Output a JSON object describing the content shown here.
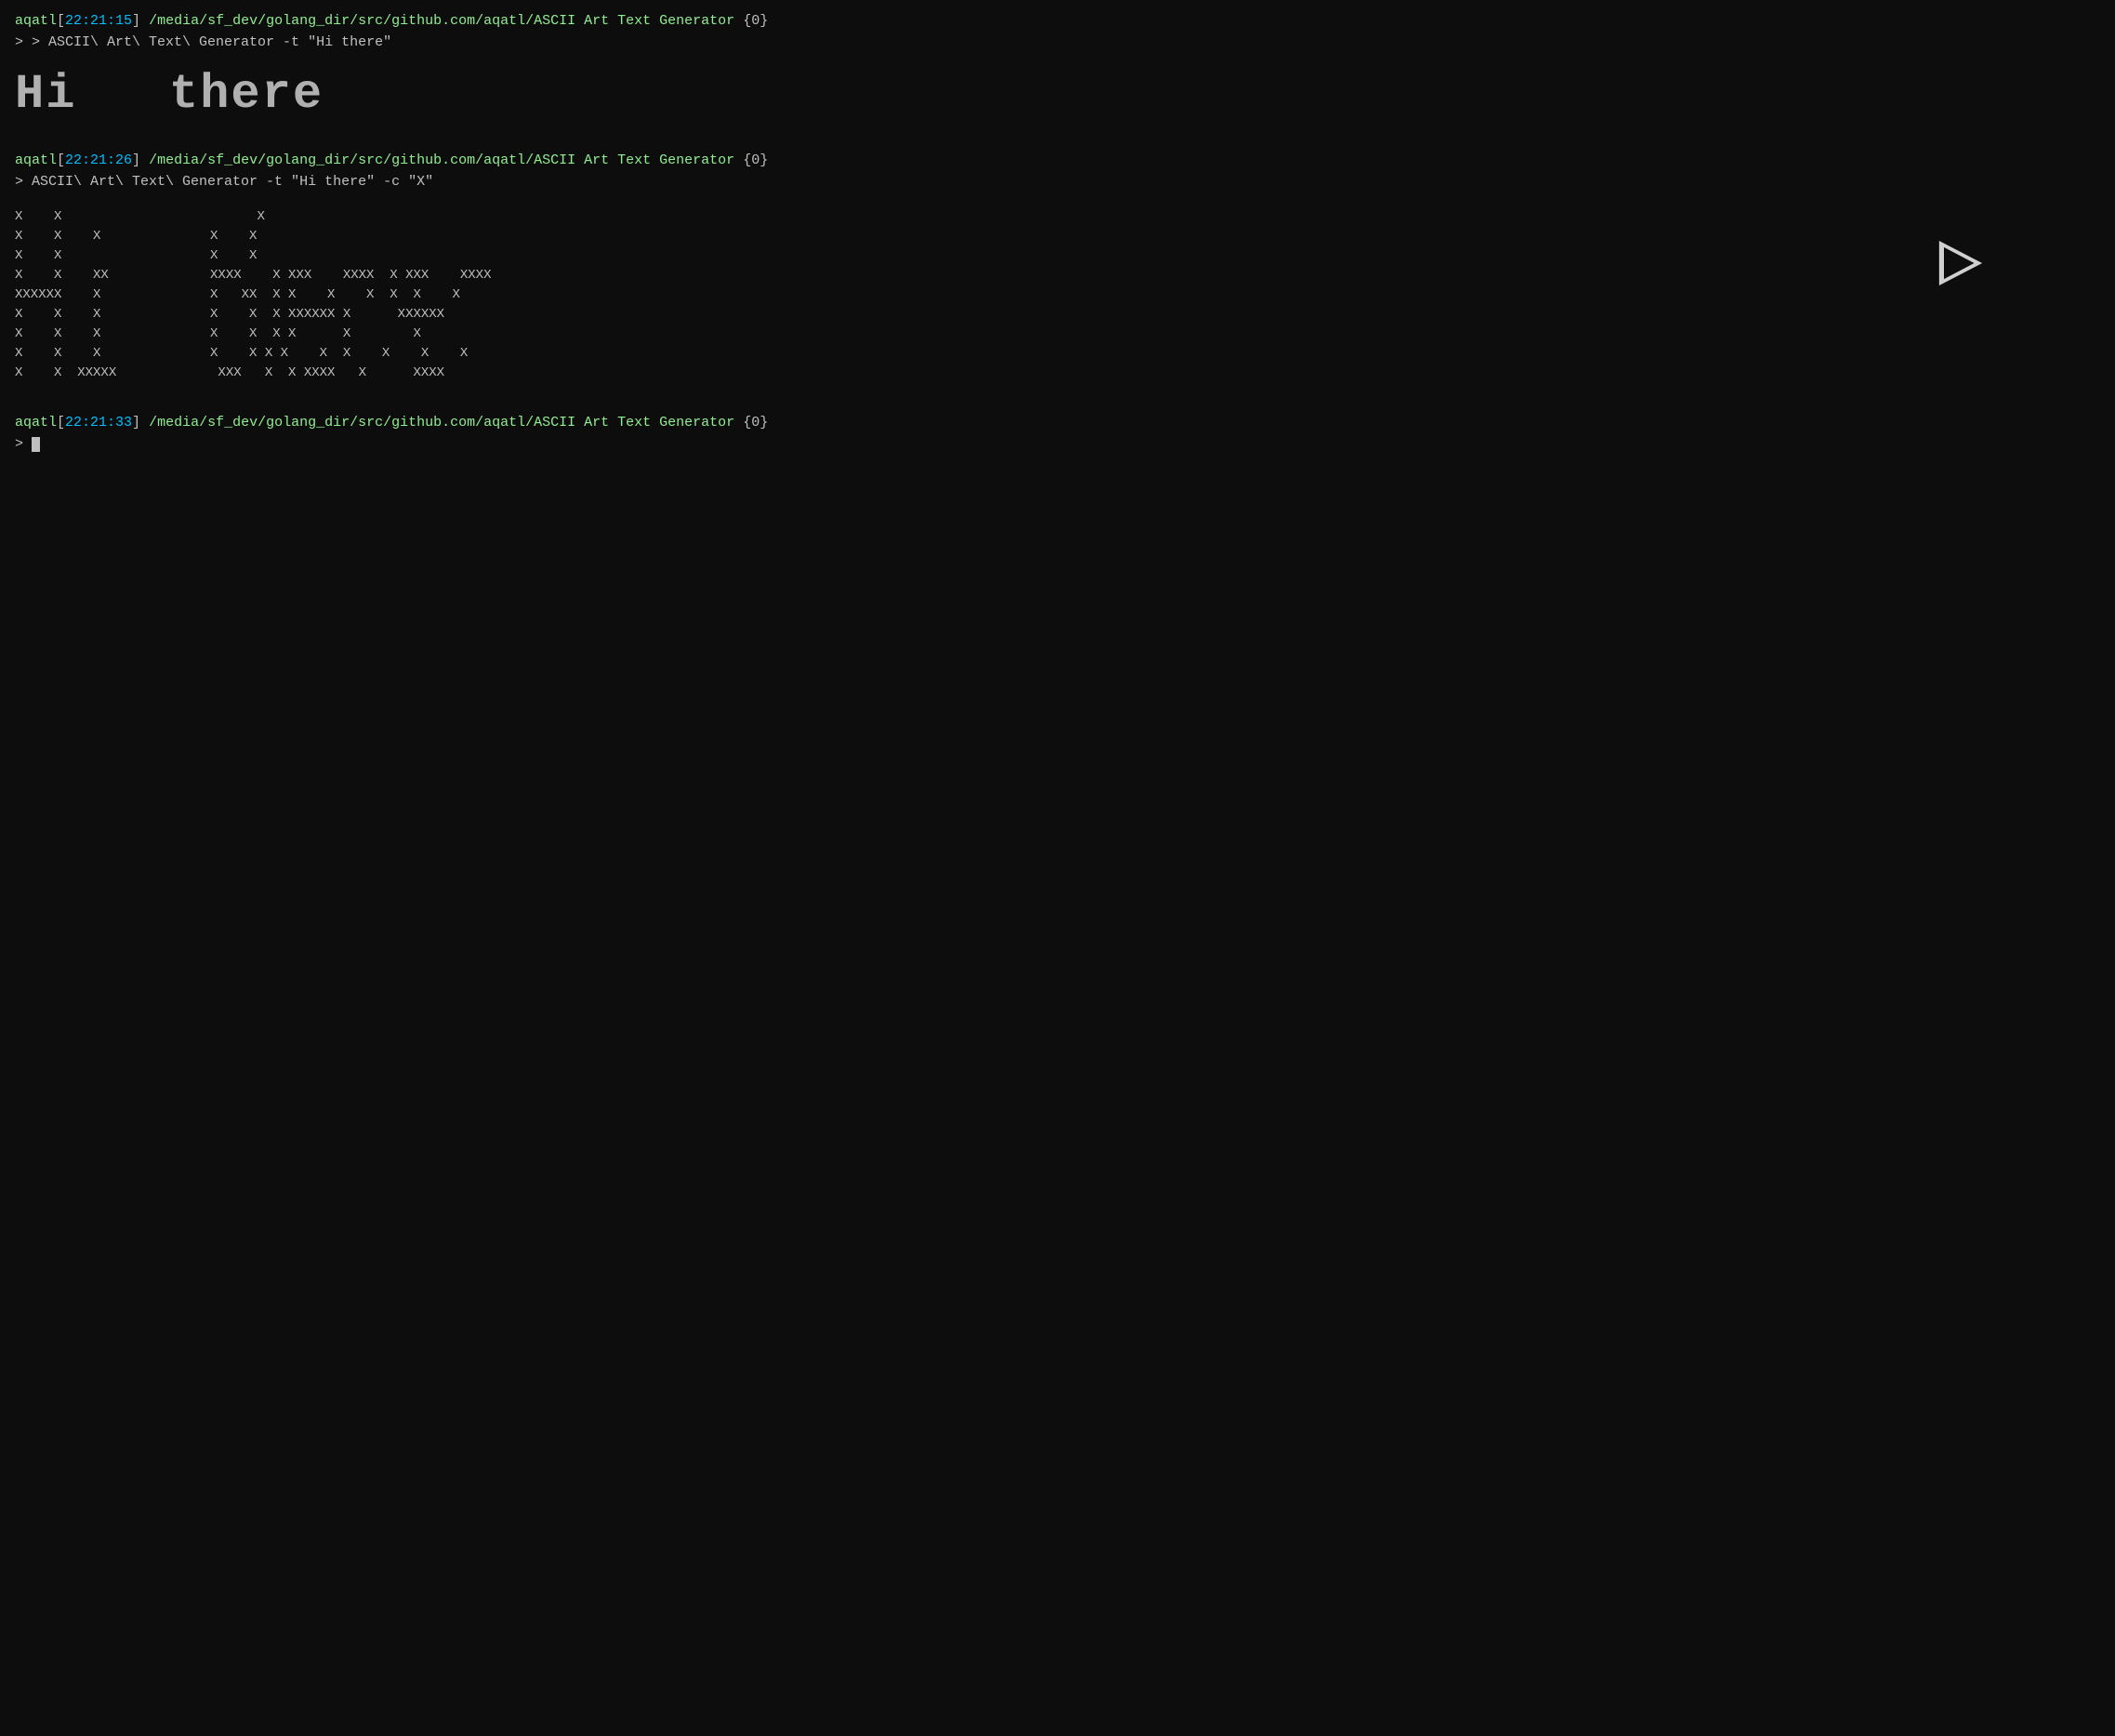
{
  "terminal": {
    "background": "#0d0d0d",
    "foreground": "#c0c0c0",
    "username_color": "#90ee90",
    "timestamp_color": "#00bfff",
    "path_color": "#90ee90",
    "blocks": [
      {
        "id": "block1",
        "prompt": {
          "username": "aqatl",
          "timestamp": "22:21:15",
          "path": "/media/sf_dev/golang_dir/src/github.com/aqatl/ASCII Art Text Generator",
          "exit_code": "{0}"
        },
        "command": "ASCII\\ Art\\ Text\\ Generator -t \"Hi there\"",
        "output_type": "ascii_large",
        "output": "Hi  there"
      },
      {
        "id": "block2",
        "prompt": {
          "username": "aqatl",
          "timestamp": "22:21:26",
          "path": "/media/sf_dev/golang_dir/src/github.com/aqatl/ASCII Art Text Generator",
          "exit_code": "{0}"
        },
        "command": "ASCII\\ Art\\ Text\\ Generator -t \"Hi there\" -c \"X\"",
        "output_type": "ascii_x",
        "output": "X    X                         X\nX    X    X              X    X\nX    X                   X    X\nX    X    XX             XXXX    X XXX    XXXX  X XXX    XXXX\nXXXXXX    X              X   XX  X X    X    X  X X    X\nX    X    X              X    X  X XXXXXX X      XXXXXX\nX    X    X              X    X  X X      X        X\nX    X    X              X    X X X    X  X    X    X    X\nX    X  XXXXX             XXX   X  X XXXX   X      XXXX"
      },
      {
        "id": "block3",
        "prompt": {
          "username": "aqatl",
          "timestamp": "22:21:33",
          "path": "/media/sf_dev/golang_dir/src/github.com/aqatl/ASCII Art Text Generator",
          "exit_code": "{0}"
        },
        "command": "",
        "output_type": "cursor"
      }
    ],
    "labels": {
      "username1": "aqatl",
      "time1": "22:21:15",
      "path1": "/media/sf_dev/golang_dir/src/github.com/aqatl/ASCII Art Text Generator",
      "exit1": "{0}",
      "cmd1": "> ASCII\\ Art\\ Text\\ Generator -t \"Hi there\"",
      "username2": "aqatl",
      "time2": "22:21:26",
      "path2": "/media/sf_dev/golang_dir/src/github.com/aqatl/ASCII Art Text Generator",
      "exit2": "{0}",
      "cmd2": "> ASCII\\ Art\\ Text\\ Generator -t \"Hi there\" -c \"X\"",
      "username3": "aqatl",
      "time3": "22:21:33",
      "path3": "/media/sf_dev/golang_dir/src/github.com/aqatl/ASCII Art Text Generator",
      "exit3": "{0}",
      "prompt3": ">"
    }
  }
}
